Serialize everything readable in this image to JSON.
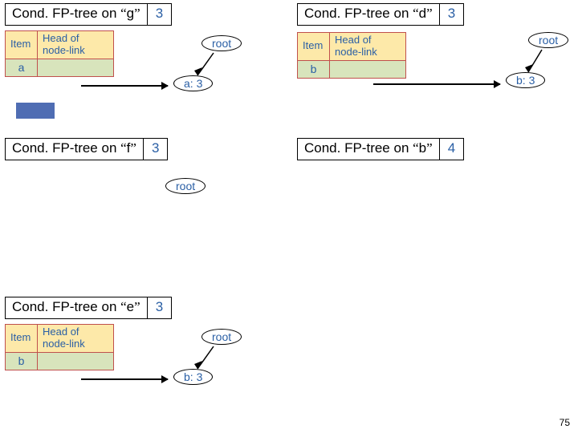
{
  "pagenum": "75",
  "panels": {
    "g": {
      "title_pre": "Cond. FP-tree on ",
      "q1": "“",
      "letter": "g",
      "q2": "”",
      "count": "3",
      "th_item": "Item",
      "th_head": "Head of\nnode-link",
      "row_item": "a",
      "root_label": "root",
      "node_label": "a: 3"
    },
    "d": {
      "title_pre": "Cond. FP-tree on ",
      "q1": "“",
      "letter": "d",
      "q2": "”",
      "count": "3",
      "th_item": "Item",
      "th_head": "Head of\nnode-link",
      "row_item": "b",
      "root_label": "root",
      "node_label": "b: 3"
    },
    "f": {
      "title_pre": "Cond. FP-tree on ",
      "q1": "“",
      "letter": "f",
      "q2": "”",
      "count": "3",
      "root_label": "root"
    },
    "b": {
      "title_pre": "Cond. FP-tree on ",
      "q1": "“",
      "letter": "b",
      "q2": "”",
      "count": "4"
    },
    "e": {
      "title_pre": "Cond. FP-tree on ",
      "q1": "“",
      "letter": "e",
      "q2": "”",
      "count": "3",
      "th_item": "Item",
      "th_head": "Head of\nnode-link",
      "row_item": "b",
      "root_label": "root",
      "node_label": "b: 3"
    }
  }
}
